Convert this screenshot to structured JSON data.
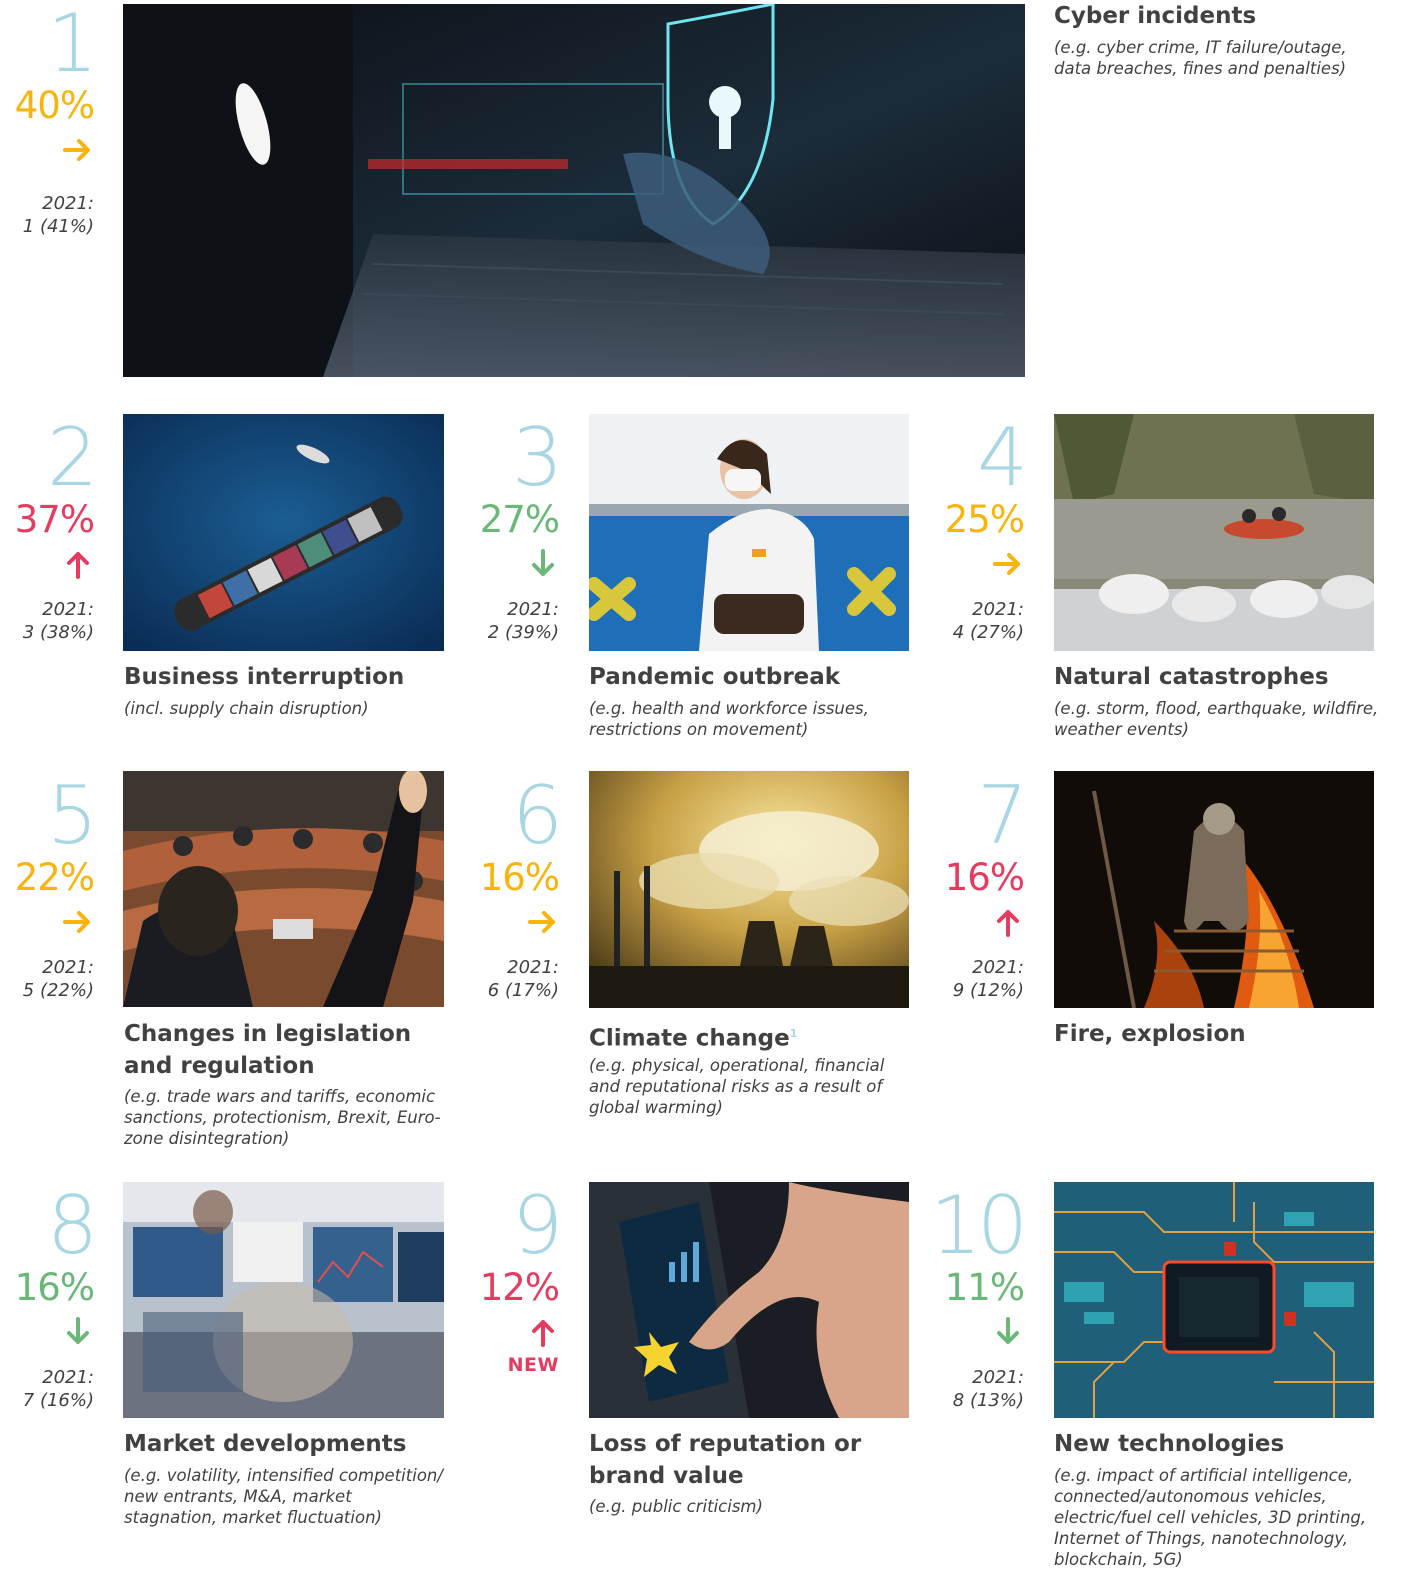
{
  "colors": {
    "rank_number": "#a9d6e3",
    "steady": "#f8b30d",
    "up": "#e53b5f",
    "down": "#69b878",
    "text": "#414141"
  },
  "previous_label": "2021:",
  "new_label": "NEW",
  "risks": [
    {
      "rank": "1",
      "percent": "40%",
      "trend": "right-arrow-icon",
      "previous": "1 (41%)",
      "title": "Cyber incidents",
      "title2": "",
      "footnote": "",
      "description": "(e.g. cyber crime, IT failure/outage,",
      "description2": "data breaches, fines and penalties)",
      "description3": "",
      "image": "cyber-security-photo"
    },
    {
      "rank": "2",
      "percent": "37%",
      "trend": "up-arrow-icon",
      "previous": "3 (38%)",
      "title": "Business interruption",
      "title2": "",
      "footnote": "",
      "description": "(incl. supply chain disruption)",
      "description2": "",
      "description3": "",
      "image": "container-ship-photo"
    },
    {
      "rank": "3",
      "percent": "27%",
      "trend": "down-arrow-icon",
      "previous": "2 (39%)",
      "title": "Pandemic outbreak",
      "title2": "",
      "footnote": "",
      "description": "(e.g. health and workforce issues,",
      "description2": "restrictions on movement)",
      "description3": "",
      "image": "masked-commuter-photo"
    },
    {
      "rank": "4",
      "percent": "25%",
      "trend": "right-arrow-icon",
      "previous": "4 (27%)",
      "title": "Natural catastrophes",
      "title2": "",
      "footnote": "",
      "description": "(e.g. storm, flood, earthquake, wildfire,",
      "description2": "weather events)",
      "description3": "",
      "image": "flood-rescue-photo"
    },
    {
      "rank": "5",
      "percent": "22%",
      "trend": "right-arrow-icon",
      "previous": "5 (22%)",
      "title": "Changes in legislation",
      "title2": "and regulation",
      "footnote": "",
      "description": "(e.g. trade wars and tariffs, economic",
      "description2": "sanctions, protectionism, Brexit, Euro-",
      "description3": "zone disintegration)",
      "image": "parliament-vote-photo"
    },
    {
      "rank": "6",
      "percent": "16%",
      "trend": "right-arrow-icon",
      "previous": "6 (17%)",
      "title": "Climate change",
      "title2": "",
      "footnote": "1",
      "description": "(e.g. physical, operational, financial",
      "description2": "and reputational risks as a result of",
      "description3": "global warming)",
      "image": "smokestack-pollution-photo"
    },
    {
      "rank": "7",
      "percent": "16%",
      "trend": "up-arrow-icon",
      "previous": "9 (12%)",
      "title": "Fire, explosion",
      "title2": "",
      "footnote": "",
      "description": "",
      "description2": "",
      "description3": "",
      "image": "firefighter-photo"
    },
    {
      "rank": "8",
      "percent": "16%",
      "trend": "down-arrow-icon",
      "previous": "7 (16%)",
      "title": "Market developments",
      "title2": "",
      "footnote": "",
      "description": "(e.g. volatility, intensified competition/",
      "description2": "new entrants, M&A, market",
      "description3": "stagnation, market fluctuation)",
      "image": "trading-floor-photo"
    },
    {
      "rank": "9",
      "percent": "12%",
      "trend": "up-arrow-icon",
      "previous": "",
      "title": "Loss of reputation or",
      "title2": "brand value",
      "footnote": "",
      "description": "(e.g. public criticism)",
      "description2": "",
      "description3": "",
      "image": "smartphone-rating-photo"
    },
    {
      "rank": "10",
      "percent": "11%",
      "trend": "down-arrow-icon",
      "previous": "8 (13%)",
      "title": "New technologies",
      "title2": "",
      "footnote": "",
      "description": "(e.g. impact of artificial intelligence,",
      "description2": "connected/autonomous vehicles,",
      "description3": "electric/fuel cell vehicles, 3D printing,",
      "description4": "Internet of Things, nanotechnology,",
      "description5": "blockchain, 5G)",
      "image": "circuit-board-photo"
    }
  ]
}
